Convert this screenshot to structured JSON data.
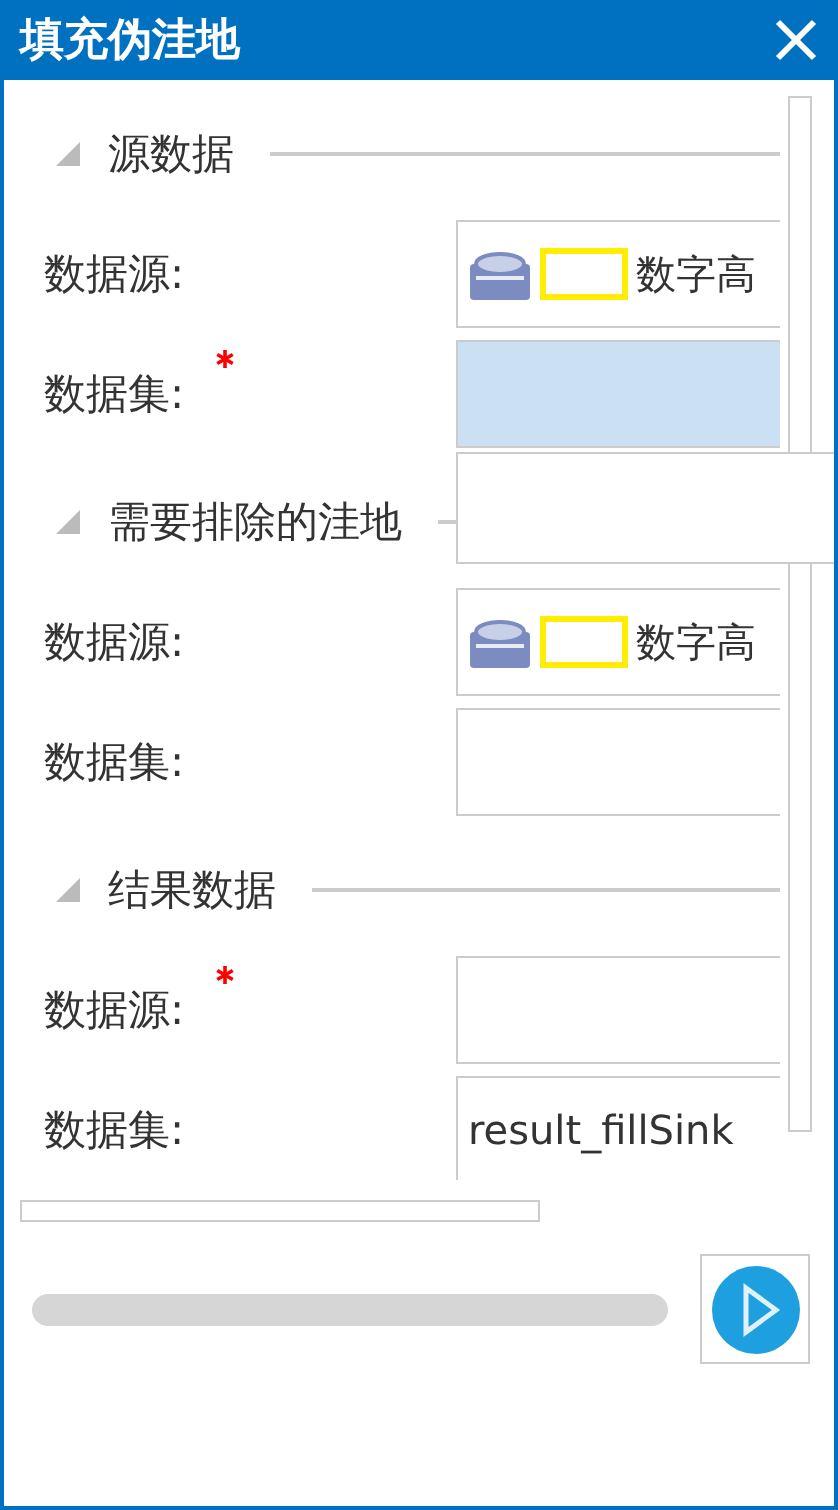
{
  "window": {
    "title": "填充伪洼地"
  },
  "sections": [
    {
      "title": "源数据",
      "expanded": true,
      "rows": [
        {
          "label": "数据源:",
          "required": false,
          "kind": "source",
          "value": "数字高",
          "selected": false
        },
        {
          "label": "数据集:",
          "required": true,
          "kind": "field",
          "selected": true
        }
      ]
    },
    {
      "title": "需要排除的洼地",
      "expanded": true,
      "rows": [
        {
          "label": "数据源:",
          "required": false,
          "kind": "source",
          "value": "数字高",
          "selected": false
        },
        {
          "label": "数据集:",
          "required": false,
          "kind": "field",
          "selected": false
        }
      ]
    },
    {
      "title": "结果数据",
      "expanded": true,
      "rows": [
        {
          "label": "数据源:",
          "required": true,
          "kind": "field",
          "selected": false
        },
        {
          "label": "数据集:",
          "required": false,
          "kind": "field",
          "value": "result_fillSink",
          "selected": false
        }
      ]
    }
  ],
  "dropdown": {
    "open": true
  }
}
